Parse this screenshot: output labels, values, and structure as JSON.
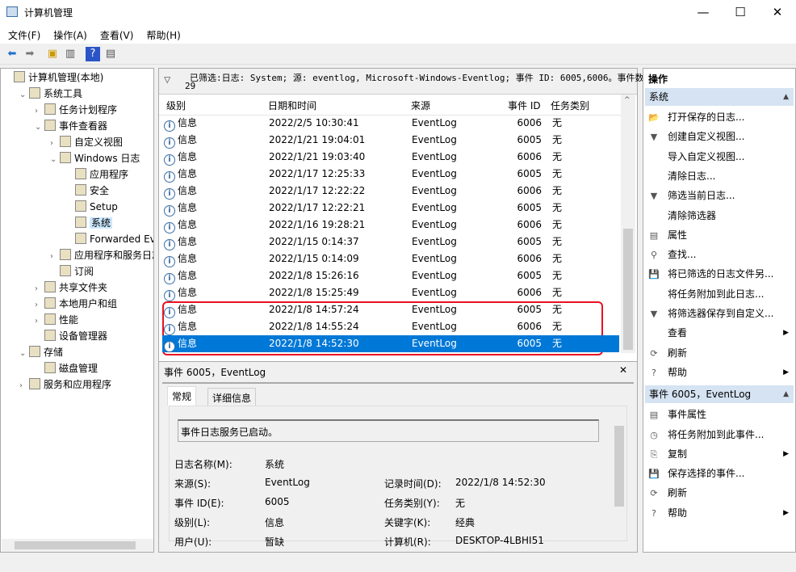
{
  "window": {
    "title": "计算机管理",
    "minimize": "—",
    "maximize": "☐",
    "close": "✕"
  },
  "menu": [
    "文件(F)",
    "操作(A)",
    "查看(V)",
    "帮助(H)"
  ],
  "tree": [
    {
      "label": "计算机管理(本地)",
      "level": 0,
      "arrow": ""
    },
    {
      "label": "系统工具",
      "level": 1,
      "arrow": "⌄"
    },
    {
      "label": "任务计划程序",
      "level": 2,
      "arrow": "›"
    },
    {
      "label": "事件查看器",
      "level": 2,
      "arrow": "⌄"
    },
    {
      "label": "自定义视图",
      "level": 3,
      "arrow": "›"
    },
    {
      "label": "Windows 日志",
      "level": 3,
      "arrow": "⌄"
    },
    {
      "label": "应用程序",
      "level": 4,
      "arrow": ""
    },
    {
      "label": "安全",
      "level": 4,
      "arrow": ""
    },
    {
      "label": "Setup",
      "level": 4,
      "arrow": ""
    },
    {
      "label": "系统",
      "level": 4,
      "arrow": "",
      "selected": true
    },
    {
      "label": "Forwarded Eve",
      "level": 4,
      "arrow": ""
    },
    {
      "label": "应用程序和服务日志",
      "level": 3,
      "arrow": "›"
    },
    {
      "label": "订阅",
      "level": 3,
      "arrow": ""
    },
    {
      "label": "共享文件夹",
      "level": 2,
      "arrow": "›"
    },
    {
      "label": "本地用户和组",
      "level": 2,
      "arrow": "›"
    },
    {
      "label": "性能",
      "level": 2,
      "arrow": "›"
    },
    {
      "label": "设备管理器",
      "level": 2,
      "arrow": ""
    },
    {
      "label": "存储",
      "level": 1,
      "arrow": "⌄"
    },
    {
      "label": "磁盘管理",
      "level": 2,
      "arrow": ""
    },
    {
      "label": "服务和应用程序",
      "level": 1,
      "arrow": "›"
    }
  ],
  "filter": {
    "text": "已筛选:日志: System; 源: eventlog, Microsoft-Windows-Eventlog; 事件 ID: 6005,6006。事件数:",
    "count": "29"
  },
  "columns": [
    "级别",
    "日期和时间",
    "来源",
    "事件 ID",
    "任务类别"
  ],
  "events": [
    [
      "信息",
      "2022/2/5 10:30:41",
      "EventLog",
      "6006",
      "无"
    ],
    [
      "信息",
      "2022/1/21 19:04:01",
      "EventLog",
      "6005",
      "无"
    ],
    [
      "信息",
      "2022/1/21 19:03:40",
      "EventLog",
      "6006",
      "无"
    ],
    [
      "信息",
      "2022/1/17 12:25:33",
      "EventLog",
      "6005",
      "无"
    ],
    [
      "信息",
      "2022/1/17 12:22:22",
      "EventLog",
      "6006",
      "无"
    ],
    [
      "信息",
      "2022/1/17 12:22:21",
      "EventLog",
      "6005",
      "无"
    ],
    [
      "信息",
      "2022/1/16 19:28:21",
      "EventLog",
      "6006",
      "无"
    ],
    [
      "信息",
      "2022/1/15 0:14:37",
      "EventLog",
      "6005",
      "无"
    ],
    [
      "信息",
      "2022/1/15 0:14:09",
      "EventLog",
      "6006",
      "无"
    ],
    [
      "信息",
      "2022/1/8 15:26:16",
      "EventLog",
      "6005",
      "无"
    ],
    [
      "信息",
      "2022/1/8 15:25:49",
      "EventLog",
      "6006",
      "无"
    ],
    [
      "信息",
      "2022/1/8 14:57:24",
      "EventLog",
      "6005",
      "无"
    ],
    [
      "信息",
      "2022/1/8 14:55:24",
      "EventLog",
      "6006",
      "无"
    ],
    [
      "信息",
      "2022/1/8 14:52:30",
      "EventLog",
      "6005",
      "无"
    ]
  ],
  "detail": {
    "title": "事件 6005，EventLog",
    "close": "✕",
    "tabs": [
      "常规",
      "详细信息"
    ],
    "message": "事件日志服务已启动。",
    "fields": [
      {
        "label": "日志名称(M):",
        "value": "系统"
      },
      {
        "label": "来源(S):",
        "value": "EventLog"
      },
      {
        "label": "事件 ID(E):",
        "value": "6005"
      },
      {
        "label": "级别(L):",
        "value": "信息"
      },
      {
        "label": "用户(U):",
        "value": "暂缺"
      },
      {
        "label": "记录时间(D):",
        "value": "2022/1/8 14:52:30"
      },
      {
        "label": "任务类别(Y):",
        "value": "无"
      },
      {
        "label": "关键字(K):",
        "value": "经典"
      },
      {
        "label": "计算机(R):",
        "value": "DESKTOP-4LBHI51"
      }
    ]
  },
  "actions": {
    "title": "操作",
    "sections": [
      {
        "header": "系统",
        "items": [
          {
            "icon": "📂",
            "label": "打开保存的日志..."
          },
          {
            "icon": "▼",
            "label": "创建自定义视图..."
          },
          {
            "icon": "",
            "label": "导入自定义视图..."
          },
          {
            "icon": "",
            "label": "清除日志..."
          },
          {
            "icon": "▼",
            "label": "筛选当前日志..."
          },
          {
            "icon": "",
            "label": "清除筛选器"
          },
          {
            "icon": "▤",
            "label": "属性"
          },
          {
            "icon": "⚲",
            "label": "查找..."
          },
          {
            "icon": "💾",
            "label": "将已筛选的日志文件另..."
          },
          {
            "icon": "",
            "label": "将任务附加到此日志..."
          },
          {
            "icon": "▼",
            "label": "将筛选器保存到自定义..."
          },
          {
            "icon": "",
            "label": "查看",
            "sub": true
          },
          {
            "icon": "⟳",
            "label": "刷新"
          },
          {
            "icon": "?",
            "label": "帮助",
            "sub": true
          }
        ]
      },
      {
        "header": "事件 6005，EventLog",
        "items": [
          {
            "icon": "▤",
            "label": "事件属性"
          },
          {
            "icon": "◷",
            "label": "将任务附加到此事件..."
          },
          {
            "icon": "⎘",
            "label": "复制",
            "sub": true
          },
          {
            "icon": "💾",
            "label": "保存选择的事件..."
          },
          {
            "icon": "⟳",
            "label": "刷新"
          },
          {
            "icon": "?",
            "label": "帮助",
            "sub": true
          }
        ]
      }
    ]
  }
}
